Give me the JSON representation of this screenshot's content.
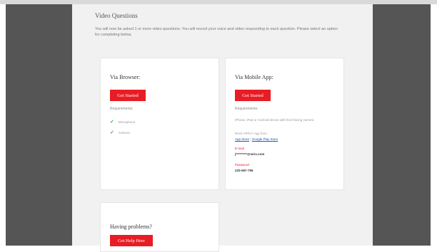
{
  "section": {
    "title": "Video Questions",
    "intro": "You will now be asked 1 or more video questions. You will record your voice and video responding to each question. Please select an option for completing below."
  },
  "browser": {
    "title": "Via Browser:",
    "button": "Get Started",
    "requirements_label": "Requirements:",
    "requirements": [
      "Microphone",
      "Camera"
    ]
  },
  "mobile": {
    "title": "Via Mobile App:",
    "button": "Get Started",
    "requirements_label": "Requirements:",
    "device_text": "iPhone, iPad or Android device with front facing camera",
    "app_text": "RIVS APPLY App from",
    "app_store_link": "App Store",
    "separator": "|",
    "play_store_link": "Google Play Store",
    "email_label": "E-mail",
    "email_value": "j*********@mirs.com",
    "password_label": "Password",
    "password_value": "220-587-795"
  },
  "help": {
    "title": "Having problems?",
    "button": "Get Help Here"
  },
  "colors": {
    "accent": "#e81c24",
    "check": "#33b533",
    "link": "#2255aa"
  }
}
